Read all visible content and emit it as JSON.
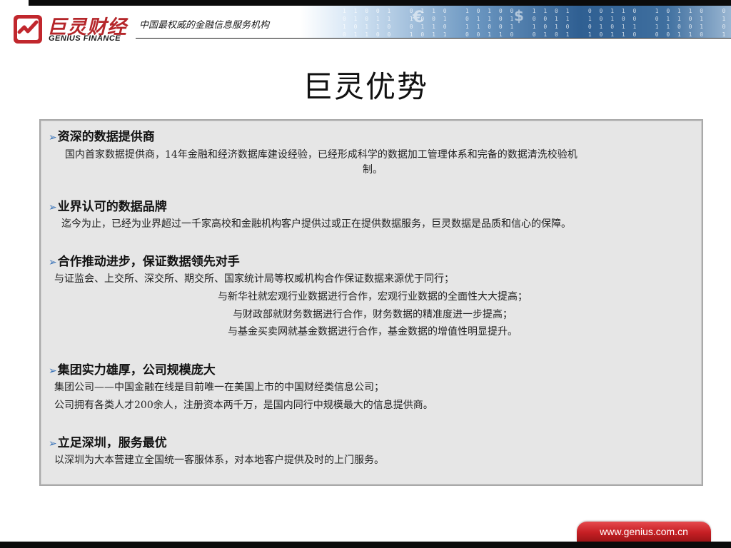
{
  "header": {
    "logo_cn": "巨灵财经",
    "logo_en": "GENIUS FINANCE",
    "slogan": "中国最权威的金融信息服务机构",
    "logo_icon": "chart-check-icon",
    "colors": {
      "brand_red": "#b5262a",
      "banner_blue": "#2f5f92"
    }
  },
  "title": "巨灵优势",
  "sections": [
    {
      "heading": "资深的数据提供商",
      "lines": [
        "国内首家数据提供商，14年金融和经济数据库建设经验，已经形成科学的数据加工管理体系和完备的数据清洗校验机",
        "制。"
      ]
    },
    {
      "heading": "业界认可的数据品牌",
      "lines": [
        "迄今为止，已经为业界超过一千家高校和金融机构客户提供过或正在提供数据服务，巨灵数据是品质和信心的保障。"
      ]
    },
    {
      "heading": "合作推动进步，保证数据领先对手",
      "lines": [
        "与证监会、上交所、深交所、期交所、国家统计局等权威机构合作保证数据来源优于同行；",
        "与新华社就宏观行业数据进行合作，宏观行业数据的全面性大大提高；",
        "与财政部就财务数据进行合作，财务数据的精准度进一步提高；",
        "与基金买卖网就基金数据进行合作，基金数据的增值性明显提升。"
      ]
    },
    {
      "heading": "集团实力雄厚，公司规模庞大",
      "lines": [
        "集团公司——中国金融在线是目前唯一在美国上市的中国财经类信息公司；",
        "公司拥有各类人才200余人，注册资本两千万，是国内同行中规模最大的信息提供商。"
      ]
    },
    {
      "heading": "立足深圳，服务最优",
      "lines": [
        "以深圳为大本营建立全国统一客服体系，对本地客户提供及时的上门服务。"
      ]
    }
  ],
  "footer": {
    "url": "www.genius.com.cn"
  }
}
